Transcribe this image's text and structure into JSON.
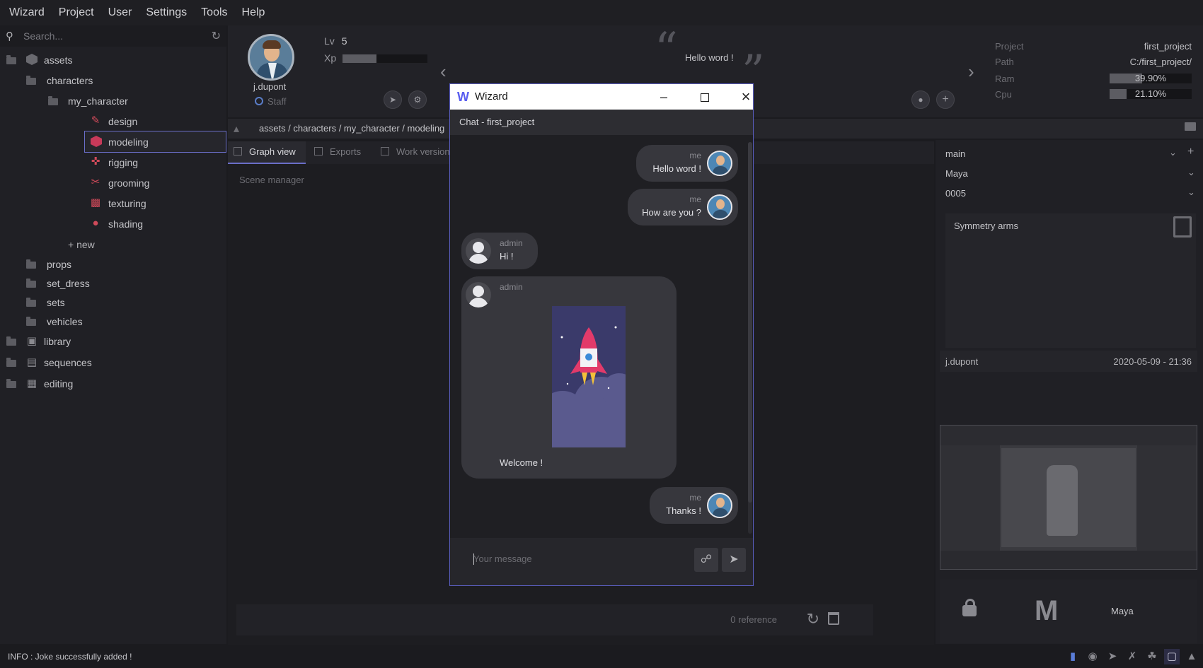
{
  "menu": [
    "Wizard",
    "Project",
    "User",
    "Settings",
    "Tools",
    "Help"
  ],
  "search": {
    "placeholder": "Search..."
  },
  "tree": {
    "assets": "assets",
    "characters": "characters",
    "my_character": "my_character",
    "steps": [
      "design",
      "modeling",
      "rigging",
      "grooming",
      "texturing",
      "shading"
    ],
    "new": "+ new",
    "folders": [
      "props",
      "set_dress",
      "sets",
      "vehicles"
    ],
    "roots": [
      "library",
      "sequences",
      "editing"
    ]
  },
  "user": {
    "name": "j.dupont",
    "role": "Staff",
    "lv_label": "Lv",
    "level": "5",
    "xp_label": "Xp",
    "xp_fraction": 0.4
  },
  "joke": {
    "text": "Hello word !"
  },
  "project_info": {
    "project_label": "Project",
    "project": "first_project",
    "path_label": "Path",
    "path": "C:/first_project/",
    "ram_label": "Ram",
    "ram": "39.90%",
    "ram_value": 0.399,
    "cpu_label": "Cpu",
    "cpu": "21.10%",
    "cpu_value": 0.211
  },
  "breadcrumb": "assets / characters / my_character / modeling",
  "tabs": [
    "Graph view",
    "Exports",
    "Work version"
  ],
  "scene_manager": "Scene manager",
  "references": "0 reference",
  "right": {
    "branch": "main",
    "software": "Maya",
    "version": "0005",
    "note": "Symmetry arms",
    "author": "j.dupont",
    "date": "2020-05-09 - 21:36",
    "app_label": "Maya",
    "app_logo": "M"
  },
  "status": "INFO : Joke successfully added !",
  "dialog": {
    "title": "Wizard",
    "chat_title": "Chat - first_project",
    "input_placeholder": "Your message",
    "messages": [
      {
        "author": "me",
        "text": "Hello word !"
      },
      {
        "author": "me",
        "text": "How are you ?"
      },
      {
        "author": "admin",
        "text": "Hi !"
      },
      {
        "author": "admin",
        "text": "Welcome !"
      },
      {
        "author": "me",
        "text": "Thanks !"
      }
    ]
  },
  "colors": {
    "accent": "#6a6ec8",
    "step_icon": "#d04a5a",
    "rocket": "#e23a6a",
    "flame": "#f2c13a"
  }
}
